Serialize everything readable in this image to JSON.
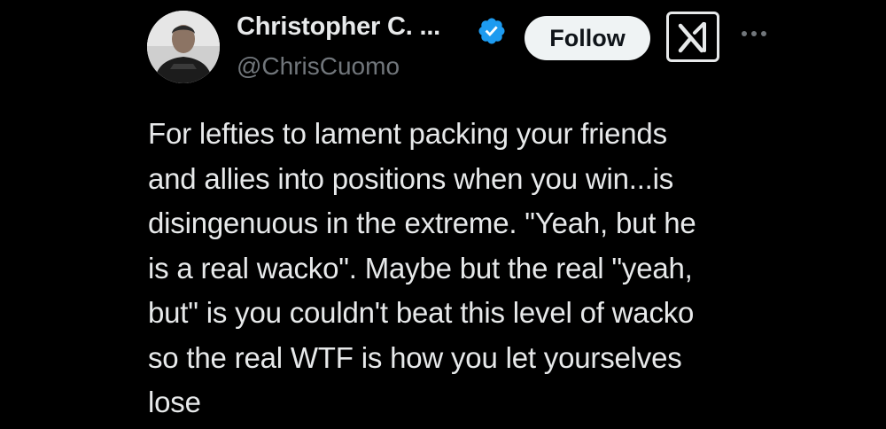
{
  "author": {
    "display_name": "Christopher C. ...",
    "handle": "@ChrisCuomo",
    "verified": true,
    "avatar_icon": "profile-photo-icon"
  },
  "actions": {
    "follow_label": "Follow",
    "grok_icon": "grok-icon",
    "more_icon": "more-options-icon"
  },
  "tweet": {
    "lines": [
      "For lefties to lament packing your friends",
      "and allies into positions when you win...is",
      "disingenuous in the extreme. \"Yeah, but he",
      "is a real wacko\". Maybe but the real \"yeah,",
      "but\" is you couldn't beat this level of wacko",
      "so the real WTF is how you let yourselves",
      "lose"
    ]
  },
  "colors": {
    "background": "#000000",
    "text": "#e7e9ea",
    "secondary_text": "#71767b",
    "verified_blue": "#1d9bf0",
    "follow_bg": "#eff3f4"
  }
}
